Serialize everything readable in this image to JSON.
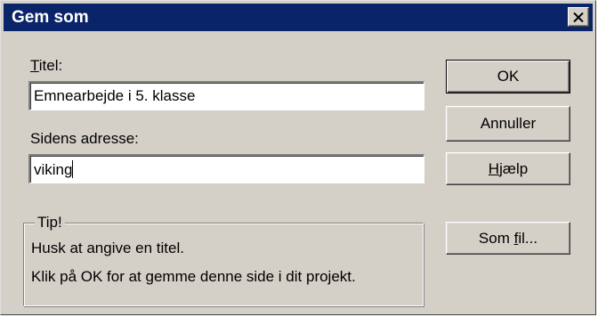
{
  "window": {
    "title": "Gem som",
    "close_icon": "close-x-icon"
  },
  "form": {
    "title_label_accel": "T",
    "title_label_rest": "itel:",
    "title_value": "Emnearbejde i 5. klasse",
    "address_label": "Sidens adresse:",
    "address_value": "viking"
  },
  "buttons": {
    "ok": "OK",
    "cancel": "Annuller",
    "help_accel": "H",
    "help_rest": "jælp",
    "as_file_prefix": "Som ",
    "as_file_accel": "f",
    "as_file_rest": "il..."
  },
  "tip": {
    "title": "Tip!",
    "line1": "Husk at angive en titel.",
    "line2": "Klik på OK for at gemme denne side i dit projekt."
  },
  "colors": {
    "titlebar": "#0a246a",
    "face": "#d4d0c8"
  }
}
